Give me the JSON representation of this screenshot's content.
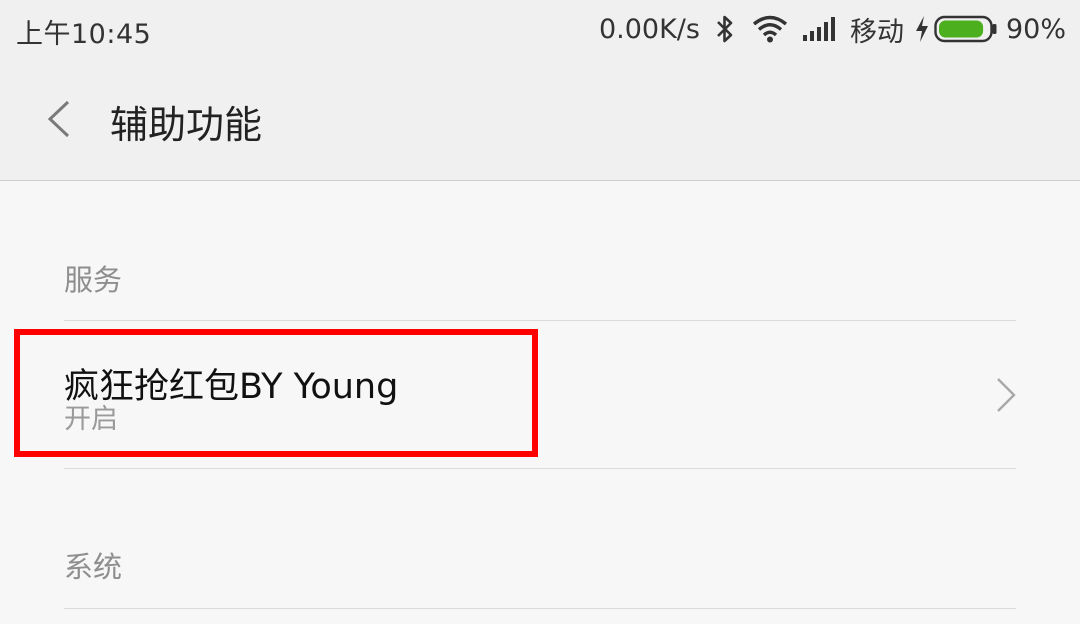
{
  "status_bar": {
    "time": "上午10:45",
    "net_speed": "0.00K/s",
    "carrier": "移动",
    "battery_percent": "90%",
    "battery_level": 0.9,
    "battery_color": "#4caf1e",
    "icons": [
      "bluetooth-icon",
      "wifi-icon",
      "signal-icon",
      "charging-icon",
      "battery-icon"
    ]
  },
  "title_bar": {
    "back_icon": "chevron-left-icon",
    "title": "辅助功能"
  },
  "sections": {
    "services": {
      "header": "服务",
      "items": [
        {
          "title": "疯狂抢红包BY Young",
          "status": "开启",
          "icon": "chevron-right-icon"
        }
      ]
    },
    "system": {
      "header": "系统"
    }
  },
  "highlight_color": "#ff0000"
}
